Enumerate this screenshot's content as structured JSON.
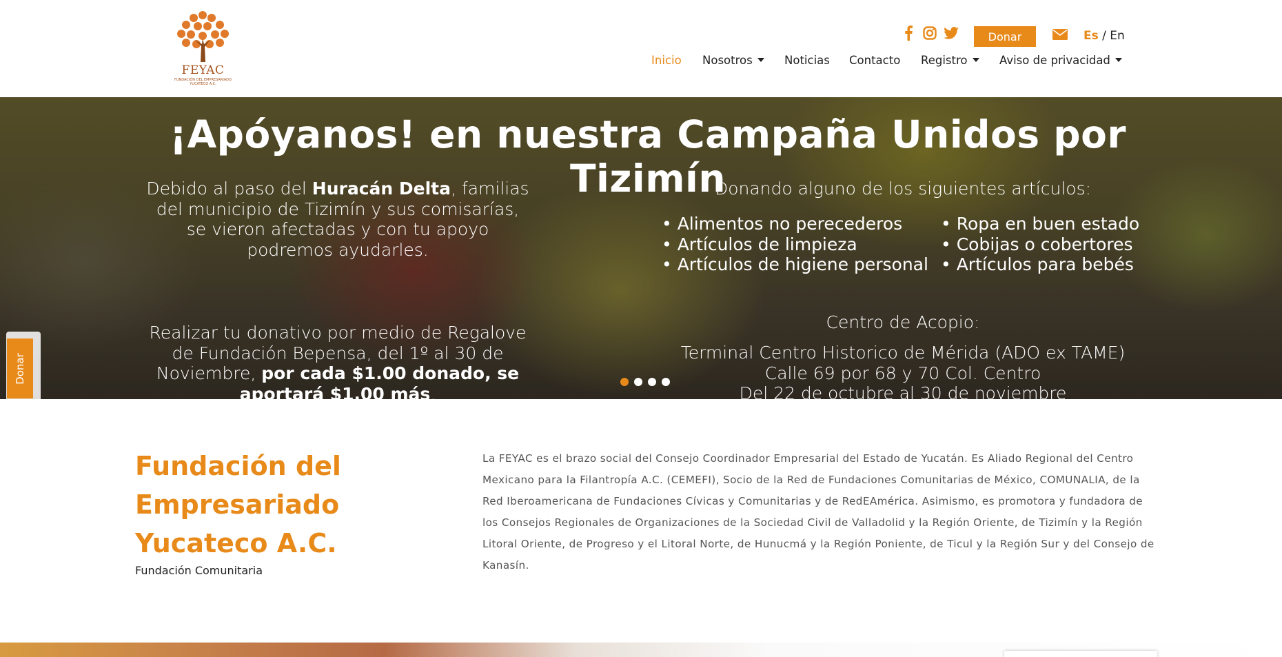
{
  "header": {
    "logo_text": "FEYAC",
    "logo_subtext": "FUNDACIÓN DEL EMPRESARIADO YUCATECO A.C.",
    "social": [
      {
        "icon": "facebook-icon"
      },
      {
        "icon": "instagram-icon"
      },
      {
        "icon": "twitter-icon"
      }
    ],
    "donate_label": "Donar",
    "mail_icon": "mail-icon",
    "lang_es": "Es",
    "lang_sep": " / ",
    "lang_en": "En",
    "nav": [
      {
        "label": "Inicio",
        "active": true
      },
      {
        "label": "Nosotros",
        "dropdown": true
      },
      {
        "label": "Noticias"
      },
      {
        "label": "Contacto"
      },
      {
        "label": "Registro",
        "dropdown": true
      },
      {
        "label": "Aviso de privacidad",
        "dropdown": true
      }
    ]
  },
  "hero": {
    "title": "¡Apóyanos! en nuestra Campaña Unidos por Tizimín",
    "left_p1_a": "Debido al paso del ",
    "left_p1_b": "Huracán Delta",
    "left_p1_c": ", familias del municipio de Tizimín y sus comisarías, se vieron afectadas y con tu apoyo podremos ayudarles.",
    "left_p2_a": "Realizar tu donativo por medio de Regalove de Fundación Bepensa, del 1º al 30 de Noviembre, ",
    "left_p2_b": "por cada $1.00 donado, se aportará $1.00 más",
    "left_p2_c": ".",
    "right_heading": "Donando alguno de los siguientes artículos:",
    "list_left": [
      "• Alimentos no perecederos",
      "• Artículos de limpieza",
      "• Artículos de higiene personal"
    ],
    "list_right": [
      "• Ropa en buen estado",
      "• Cobijas o cobertores",
      "• Artículos para bebés"
    ],
    "acopio_heading": "Centro de Acopio:",
    "acopio_lines": [
      "Terminal Centro Historico de Mérida (ADO ex TAME)",
      "Calle 69 por 68 y 70 Col. Centro",
      "Del 22 de octubre al 30 de noviembre"
    ],
    "slides": 4,
    "active_slide": 0,
    "side_donate_label": "Donar"
  },
  "about": {
    "title": "Fundación del Empresariado Yucateco A.C.",
    "subtitle": "Fundación Comunitaria",
    "text": "La FEYAC es el brazo social del Consejo Coordinador Empresarial del Estado de Yucatán. Es Aliado Regional del Centro Mexicano para la Filantropía A.C. (CEMEFI), Socio de la Red de Fundaciones Comunitarias de México, COMUNALIA, de la Red Iberoamericana de Fundaciones Cívicas y Comunitarias y de RedEAmérica. Asimismo, es promotora y fundadora de los Consejos Regionales de Organizaciones de la Sociedad Civil de Valladolid y la Región Oriente, de Tizimín y la Región Litoral Oriente, de Progreso y el Litoral Norte, de Hunucmá y la Región Poniente, de Ticul y la Región Sur y del Consejo de Kanasín."
  },
  "colors": {
    "accent": "#e88a1a",
    "logo": "#a6531f"
  }
}
